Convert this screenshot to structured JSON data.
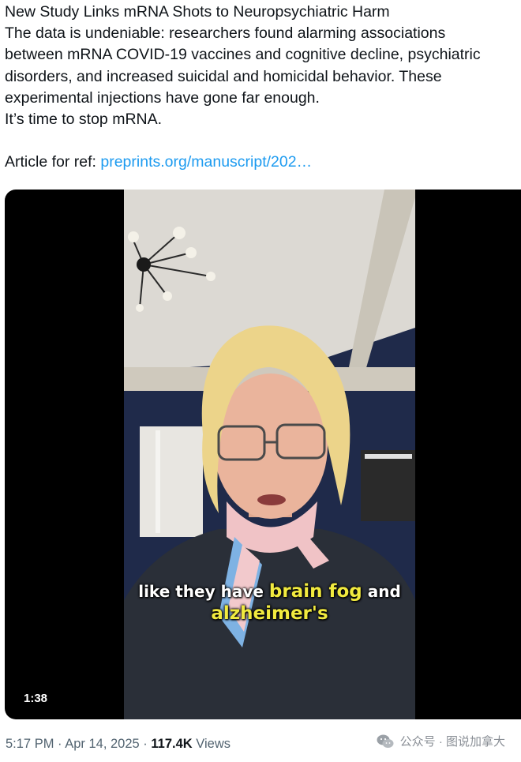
{
  "tweet": {
    "lines": [
      "New Study Links mRNA Shots to Neuropsychiatric Harm",
      "The data is undeniable: researchers found alarming associations",
      "between mRNA COVID-19 vaccines and cognitive decline, psychiatric",
      "disorders, and increased suicidal and homicidal behavior. These",
      "experimental injections have gone far enough.",
      "It’s time to stop mRNA."
    ],
    "ref_label": "Article for ref: ",
    "ref_link": "preprints.org/manuscript/202…"
  },
  "video": {
    "caption_part1": "like they have ",
    "caption_highlight": "brain fog",
    "caption_part2": " and",
    "caption_line2": "alzheimer's",
    "duration": "1:38"
  },
  "meta": {
    "time": "5:17 PM",
    "separator": " · ",
    "date": "Apr 14, 2025",
    "views_count": "117.4K",
    "views_label": " Views"
  },
  "watermark": {
    "icon": "wechat-icon",
    "text": "公众号 · 图说加拿大"
  },
  "colors": {
    "link": "#1d9bf0",
    "caption_highlight": "#f1ea3f",
    "meta_text": "#536471"
  }
}
